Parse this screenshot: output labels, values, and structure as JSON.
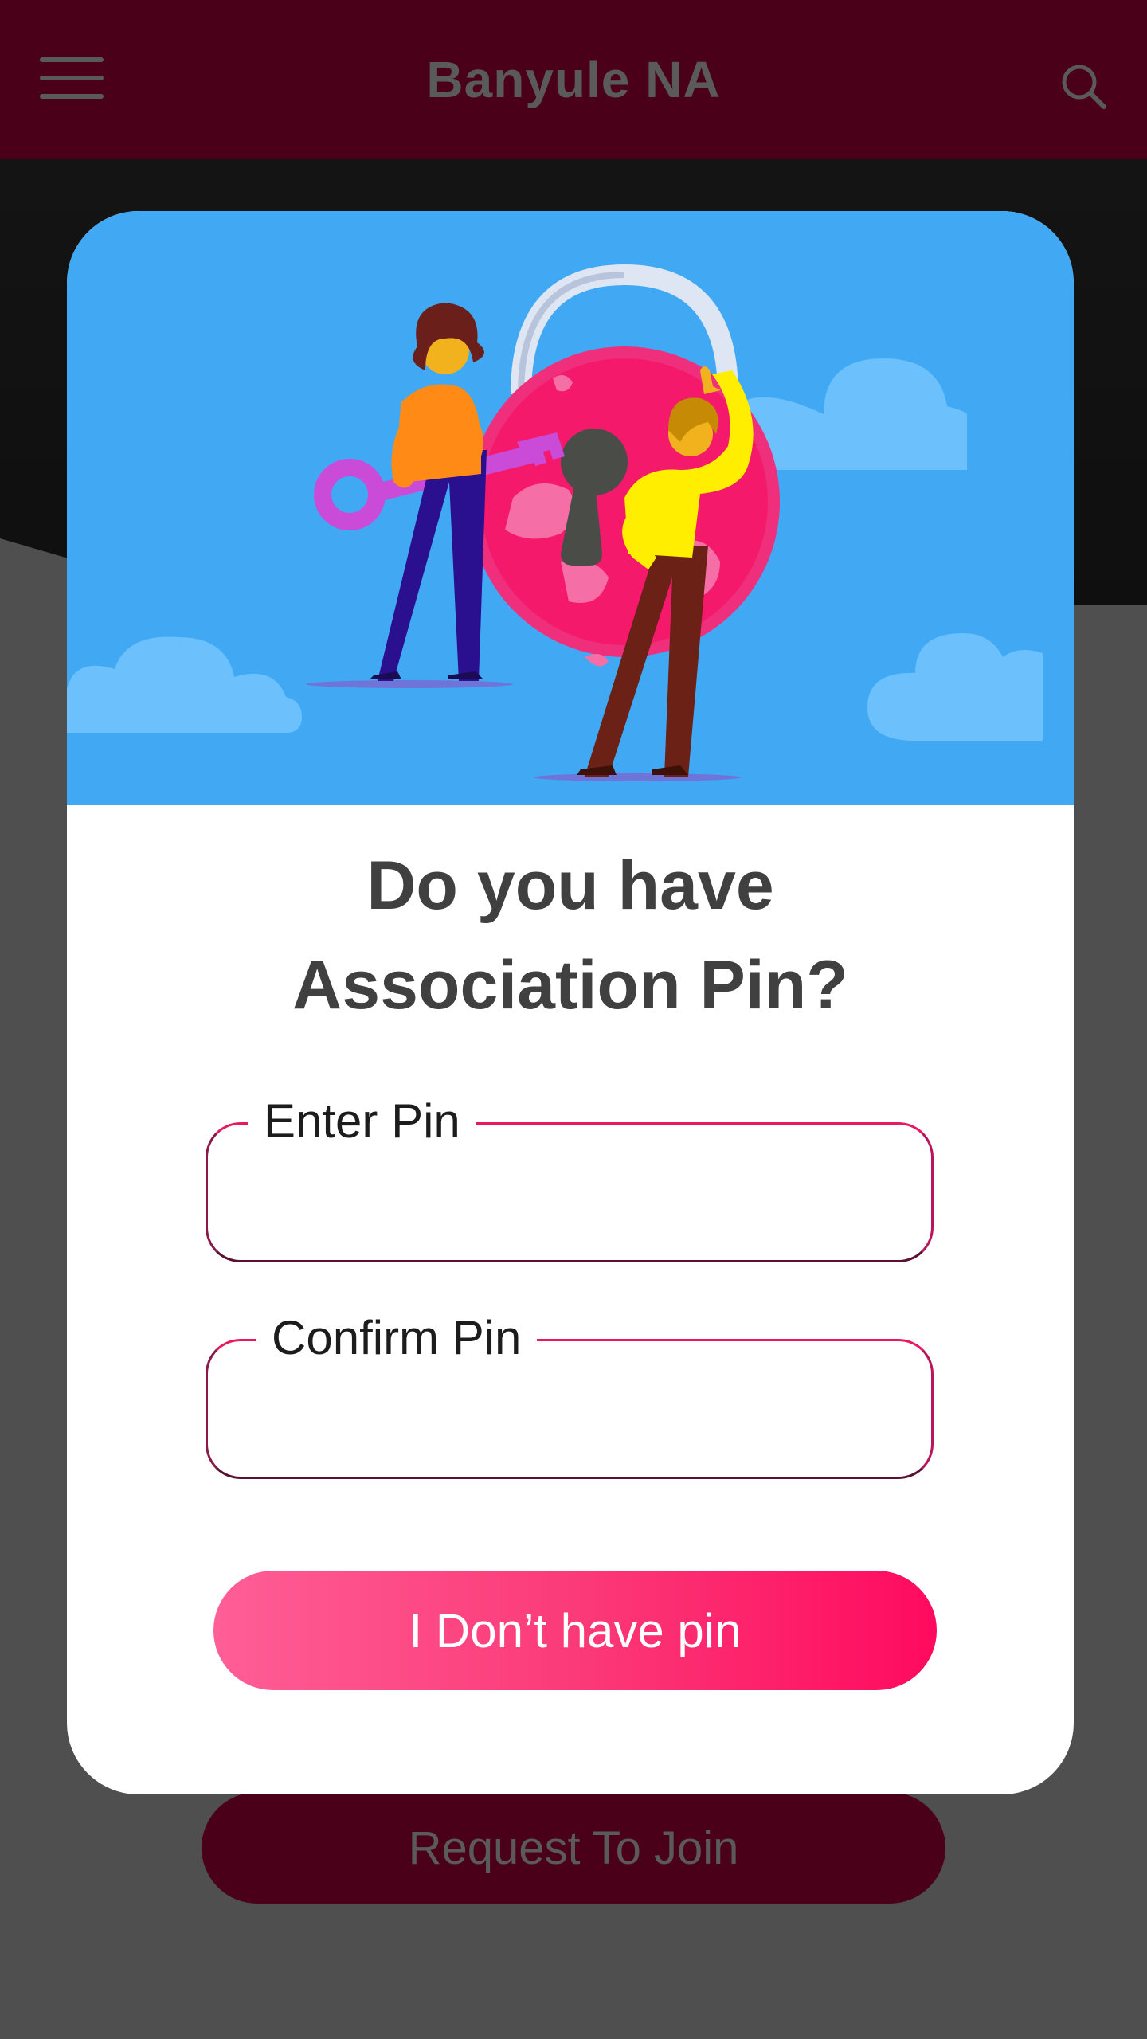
{
  "appbar": {
    "title": "Banyule NA",
    "menu_icon": "hamburger-menu-icon",
    "search_icon": "search-icon"
  },
  "background": {
    "join_button_label": "Request To Join"
  },
  "modal": {
    "illustration": "padlock-with-key-people-illustration",
    "heading_line1": "Do you have",
    "heading_line2": "Association Pin?",
    "pin_field": {
      "label": "Enter Pin",
      "value": ""
    },
    "confirm_field": {
      "label": "Confirm Pin",
      "value": ""
    },
    "no_pin_button_label": "I Don’t have pin"
  },
  "colors": {
    "appbar_dimmed": "#4a0019",
    "overlay": "#4f4f4f",
    "sky": "#41a9f4",
    "accent": "#ff0a5e",
    "heading": "#404040"
  }
}
